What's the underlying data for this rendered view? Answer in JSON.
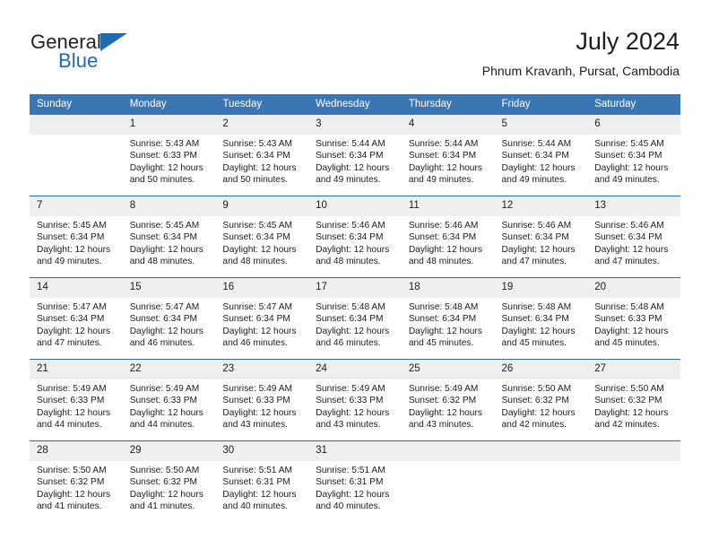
{
  "brand": {
    "name_part1": "General",
    "name_part2": "Blue",
    "triangle_icon": "triangle-icon",
    "accent_color": "#1d6cb1"
  },
  "header": {
    "title": "July 2024",
    "subtitle": "Phnum Kravanh, Pursat, Cambodia"
  },
  "theme": {
    "header_blue": "#3a76b4",
    "row_divider": "#2e6da4",
    "daynum_band": "#efefef",
    "text": "#1c1c1c"
  },
  "calendar": {
    "weekday_headers": [
      "Sunday",
      "Monday",
      "Tuesday",
      "Wednesday",
      "Thursday",
      "Friday",
      "Saturday"
    ],
    "labels": {
      "sunrise": "Sunrise:",
      "sunset": "Sunset:",
      "daylight": "Daylight:"
    },
    "weeks": [
      [
        {
          "day": "",
          "sunrise": "",
          "sunset": "",
          "daylight": "",
          "empty": true
        },
        {
          "day": "1",
          "sunrise": "Sunrise: 5:43 AM",
          "sunset": "Sunset: 6:33 PM",
          "daylight": "Daylight: 12 hours and 50 minutes.",
          "empty": false
        },
        {
          "day": "2",
          "sunrise": "Sunrise: 5:43 AM",
          "sunset": "Sunset: 6:34 PM",
          "daylight": "Daylight: 12 hours and 50 minutes.",
          "empty": false
        },
        {
          "day": "3",
          "sunrise": "Sunrise: 5:44 AM",
          "sunset": "Sunset: 6:34 PM",
          "daylight": "Daylight: 12 hours and 49 minutes.",
          "empty": false
        },
        {
          "day": "4",
          "sunrise": "Sunrise: 5:44 AM",
          "sunset": "Sunset: 6:34 PM",
          "daylight": "Daylight: 12 hours and 49 minutes.",
          "empty": false
        },
        {
          "day": "5",
          "sunrise": "Sunrise: 5:44 AM",
          "sunset": "Sunset: 6:34 PM",
          "daylight": "Daylight: 12 hours and 49 minutes.",
          "empty": false
        },
        {
          "day": "6",
          "sunrise": "Sunrise: 5:45 AM",
          "sunset": "Sunset: 6:34 PM",
          "daylight": "Daylight: 12 hours and 49 minutes.",
          "empty": false
        }
      ],
      [
        {
          "day": "7",
          "sunrise": "Sunrise: 5:45 AM",
          "sunset": "Sunset: 6:34 PM",
          "daylight": "Daylight: 12 hours and 49 minutes.",
          "empty": false
        },
        {
          "day": "8",
          "sunrise": "Sunrise: 5:45 AM",
          "sunset": "Sunset: 6:34 PM",
          "daylight": "Daylight: 12 hours and 48 minutes.",
          "empty": false
        },
        {
          "day": "9",
          "sunrise": "Sunrise: 5:45 AM",
          "sunset": "Sunset: 6:34 PM",
          "daylight": "Daylight: 12 hours and 48 minutes.",
          "empty": false
        },
        {
          "day": "10",
          "sunrise": "Sunrise: 5:46 AM",
          "sunset": "Sunset: 6:34 PM",
          "daylight": "Daylight: 12 hours and 48 minutes.",
          "empty": false
        },
        {
          "day": "11",
          "sunrise": "Sunrise: 5:46 AM",
          "sunset": "Sunset: 6:34 PM",
          "daylight": "Daylight: 12 hours and 48 minutes.",
          "empty": false
        },
        {
          "day": "12",
          "sunrise": "Sunrise: 5:46 AM",
          "sunset": "Sunset: 6:34 PM",
          "daylight": "Daylight: 12 hours and 47 minutes.",
          "empty": false
        },
        {
          "day": "13",
          "sunrise": "Sunrise: 5:46 AM",
          "sunset": "Sunset: 6:34 PM",
          "daylight": "Daylight: 12 hours and 47 minutes.",
          "empty": false
        }
      ],
      [
        {
          "day": "14",
          "sunrise": "Sunrise: 5:47 AM",
          "sunset": "Sunset: 6:34 PM",
          "daylight": "Daylight: 12 hours and 47 minutes.",
          "empty": false
        },
        {
          "day": "15",
          "sunrise": "Sunrise: 5:47 AM",
          "sunset": "Sunset: 6:34 PM",
          "daylight": "Daylight: 12 hours and 46 minutes.",
          "empty": false
        },
        {
          "day": "16",
          "sunrise": "Sunrise: 5:47 AM",
          "sunset": "Sunset: 6:34 PM",
          "daylight": "Daylight: 12 hours and 46 minutes.",
          "empty": false
        },
        {
          "day": "17",
          "sunrise": "Sunrise: 5:48 AM",
          "sunset": "Sunset: 6:34 PM",
          "daylight": "Daylight: 12 hours and 46 minutes.",
          "empty": false
        },
        {
          "day": "18",
          "sunrise": "Sunrise: 5:48 AM",
          "sunset": "Sunset: 6:34 PM",
          "daylight": "Daylight: 12 hours and 45 minutes.",
          "empty": false
        },
        {
          "day": "19",
          "sunrise": "Sunrise: 5:48 AM",
          "sunset": "Sunset: 6:34 PM",
          "daylight": "Daylight: 12 hours and 45 minutes.",
          "empty": false
        },
        {
          "day": "20",
          "sunrise": "Sunrise: 5:48 AM",
          "sunset": "Sunset: 6:33 PM",
          "daylight": "Daylight: 12 hours and 45 minutes.",
          "empty": false
        }
      ],
      [
        {
          "day": "21",
          "sunrise": "Sunrise: 5:49 AM",
          "sunset": "Sunset: 6:33 PM",
          "daylight": "Daylight: 12 hours and 44 minutes.",
          "empty": false
        },
        {
          "day": "22",
          "sunrise": "Sunrise: 5:49 AM",
          "sunset": "Sunset: 6:33 PM",
          "daylight": "Daylight: 12 hours and 44 minutes.",
          "empty": false
        },
        {
          "day": "23",
          "sunrise": "Sunrise: 5:49 AM",
          "sunset": "Sunset: 6:33 PM",
          "daylight": "Daylight: 12 hours and 43 minutes.",
          "empty": false
        },
        {
          "day": "24",
          "sunrise": "Sunrise: 5:49 AM",
          "sunset": "Sunset: 6:33 PM",
          "daylight": "Daylight: 12 hours and 43 minutes.",
          "empty": false
        },
        {
          "day": "25",
          "sunrise": "Sunrise: 5:49 AM",
          "sunset": "Sunset: 6:32 PM",
          "daylight": "Daylight: 12 hours and 43 minutes.",
          "empty": false
        },
        {
          "day": "26",
          "sunrise": "Sunrise: 5:50 AM",
          "sunset": "Sunset: 6:32 PM",
          "daylight": "Daylight: 12 hours and 42 minutes.",
          "empty": false
        },
        {
          "day": "27",
          "sunrise": "Sunrise: 5:50 AM",
          "sunset": "Sunset: 6:32 PM",
          "daylight": "Daylight: 12 hours and 42 minutes.",
          "empty": false
        }
      ],
      [
        {
          "day": "28",
          "sunrise": "Sunrise: 5:50 AM",
          "sunset": "Sunset: 6:32 PM",
          "daylight": "Daylight: 12 hours and 41 minutes.",
          "empty": false
        },
        {
          "day": "29",
          "sunrise": "Sunrise: 5:50 AM",
          "sunset": "Sunset: 6:32 PM",
          "daylight": "Daylight: 12 hours and 41 minutes.",
          "empty": false
        },
        {
          "day": "30",
          "sunrise": "Sunrise: 5:51 AM",
          "sunset": "Sunset: 6:31 PM",
          "daylight": "Daylight: 12 hours and 40 minutes.",
          "empty": false
        },
        {
          "day": "31",
          "sunrise": "Sunrise: 5:51 AM",
          "sunset": "Sunset: 6:31 PM",
          "daylight": "Daylight: 12 hours and 40 minutes.",
          "empty": false
        },
        {
          "day": "",
          "sunrise": "",
          "sunset": "",
          "daylight": "",
          "empty": true
        },
        {
          "day": "",
          "sunrise": "",
          "sunset": "",
          "daylight": "",
          "empty": true
        },
        {
          "day": "",
          "sunrise": "",
          "sunset": "",
          "daylight": "",
          "empty": true
        }
      ]
    ]
  }
}
